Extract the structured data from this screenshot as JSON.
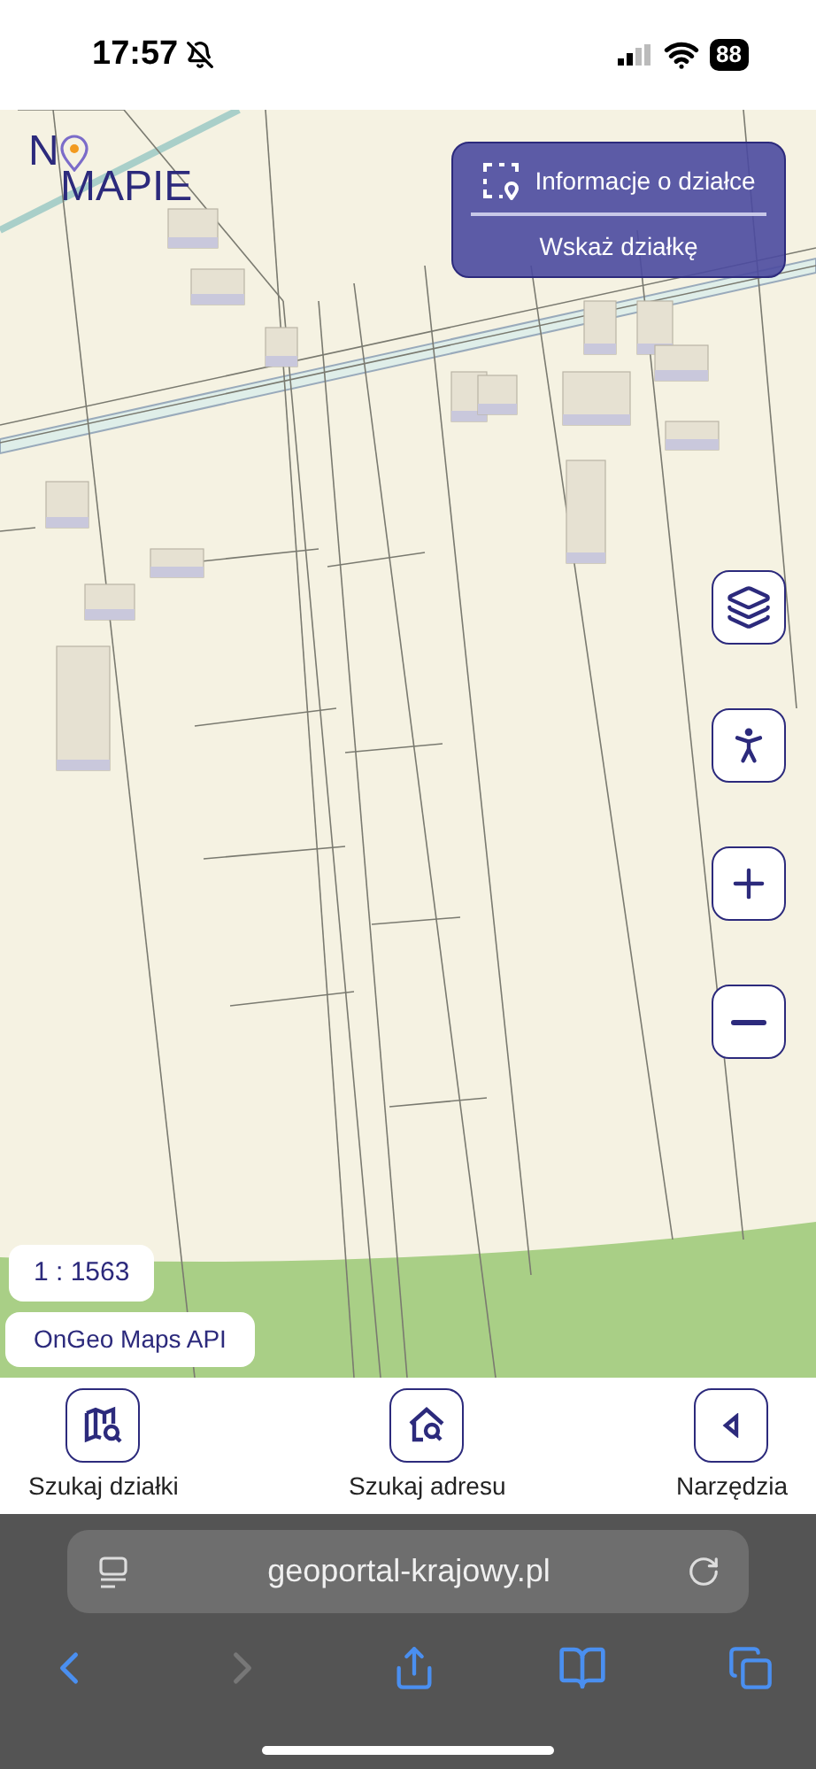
{
  "status_bar": {
    "time": "17:57",
    "battery": "88"
  },
  "logo": {
    "first": "N",
    "second": "MAPIE"
  },
  "parcel_panel": {
    "title": "Informacje o działce",
    "action": "Wskaż działkę"
  },
  "map_controls": [
    {
      "kind": "layers"
    },
    {
      "kind": "walk"
    },
    {
      "kind": "zoom-in"
    },
    {
      "kind": "zoom-out"
    }
  ],
  "scale": "1 : 1563",
  "attribution": "OnGeo Maps API",
  "bottom_nav": [
    {
      "kind": "map-search",
      "label": "Szukaj działki"
    },
    {
      "kind": "house-search",
      "label": "Szukaj adresu"
    },
    {
      "kind": "tools",
      "label": "Narzędzia"
    }
  ],
  "browser": {
    "url": "geoportal-krajowy.pl"
  }
}
